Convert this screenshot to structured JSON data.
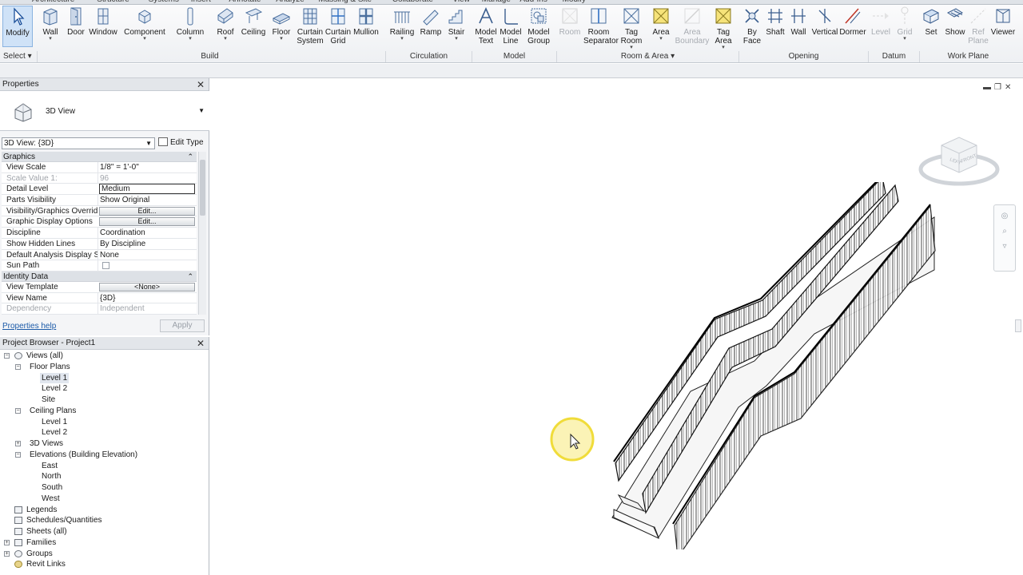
{
  "tabs": [
    "Architecture",
    "Structure",
    "Systems",
    "Insert",
    "Annotate",
    "Analyze",
    "Massing & Site",
    "Collaborate",
    "View",
    "Manage",
    "Add-Ins",
    "Modify"
  ],
  "ribbon": {
    "select": {
      "modify": "Modify",
      "select": "Select"
    },
    "build": {
      "wall": "Wall",
      "door": "Door",
      "window": "Window",
      "component": "Component",
      "column": "Column",
      "roof": "Roof",
      "ceiling": "Ceiling",
      "floor": "Floor",
      "curtain_system": [
        "Curtain",
        "System"
      ],
      "curtain_grid": [
        "Curtain",
        "Grid"
      ],
      "mullion": "Mullion",
      "panel": "Build"
    },
    "circulation": {
      "railing": "Railing",
      "ramp": "Ramp",
      "stair": "Stair",
      "panel": "Circulation"
    },
    "model": {
      "model_text": [
        "Model",
        "Text"
      ],
      "model_line": [
        "Model",
        "Line"
      ],
      "model_group": [
        "Model",
        "Group"
      ],
      "panel": "Model"
    },
    "room_area": {
      "room": "Room",
      "room_separator": [
        "Room",
        "Separator"
      ],
      "tag_room": [
        "Tag",
        "Room"
      ],
      "area": "Area",
      "area_boundary": [
        "Area",
        "Boundary"
      ],
      "tag_area": [
        "Tag",
        "Area"
      ],
      "panel": "Room & Area"
    },
    "opening": {
      "by_face": [
        "By",
        "Face"
      ],
      "shaft": "Shaft",
      "wall": "Wall",
      "vertical": "Vertical",
      "dormer": "Dormer",
      "panel": "Opening"
    },
    "datum": {
      "level": "Level",
      "grid": "Grid",
      "panel": "Datum"
    },
    "work_plane": {
      "set": "Set",
      "show": "Show",
      "ref_plane": [
        "Ref",
        "Plane"
      ],
      "viewer": "Viewer",
      "panel": "Work Plane"
    }
  },
  "properties": {
    "title": "Properties",
    "type_name": "3D View",
    "view_selector": "3D View: {3D}",
    "edit_type": "Edit Type",
    "groups": {
      "graphics": "Graphics",
      "identity": "Identity Data"
    },
    "rows": {
      "view_scale": {
        "k": "View Scale",
        "v": "1/8\" = 1'-0\""
      },
      "scale_value": {
        "k": "Scale Value    1:",
        "v": "96"
      },
      "detail_level": {
        "k": "Detail Level",
        "v": "Medium"
      },
      "parts_visibility": {
        "k": "Parts Visibility",
        "v": "Show Original"
      },
      "vg_overrides": {
        "k": "Visibility/Graphics Overrides",
        "v": "Edit..."
      },
      "graphic_display": {
        "k": "Graphic Display Options",
        "v": "Edit..."
      },
      "discipline": {
        "k": "Discipline",
        "v": "Coordination"
      },
      "hidden_lines": {
        "k": "Show Hidden Lines",
        "v": "By Discipline"
      },
      "analysis_display": {
        "k": "Default Analysis Display St...",
        "v": "None"
      },
      "sun_path": {
        "k": "Sun Path",
        "v": ""
      },
      "view_template": {
        "k": "View Template",
        "v": "<None>"
      },
      "view_name": {
        "k": "View Name",
        "v": "{3D}"
      },
      "dependency": {
        "k": "Dependency",
        "v": "Independent"
      }
    },
    "help": "Properties help",
    "apply": "Apply"
  },
  "browser": {
    "title": "Project Browser - Project1",
    "items": {
      "views_all": "Views (all)",
      "floor_plans": "Floor Plans",
      "fp_level1": "Level 1",
      "fp_level2": "Level 2",
      "fp_site": "Site",
      "ceiling_plans": "Ceiling Plans",
      "cp_level1": "Level 1",
      "cp_level2": "Level 2",
      "views_3d": "3D Views",
      "elevations": "Elevations (Building Elevation)",
      "east": "East",
      "north": "North",
      "south": "South",
      "west": "West",
      "legends": "Legends",
      "schedules": "Schedules/Quantities",
      "sheets": "Sheets (all)",
      "families": "Families",
      "groups": "Groups",
      "revit_links": "Revit Links"
    }
  },
  "viewcube": {
    "left": "LEFT",
    "front": "FRONT"
  },
  "colors": {
    "accent": "#2e6fc4",
    "cursor_highlight": "#f4e23c",
    "link": "#1b5aa8"
  },
  "icons": {
    "modify": "cursor-arrow-icon",
    "wall": "wall-icon",
    "door": "door-icon",
    "window": "window-icon",
    "component": "component-icon",
    "column": "column-icon",
    "roof": "roof-icon",
    "ceiling": "ceiling-icon",
    "floor": "floor-icon",
    "curtain_system": "curtain-system-icon",
    "curtain_grid": "curtain-grid-icon",
    "mullion": "mullion-icon",
    "railing": "railing-icon",
    "ramp": "ramp-icon",
    "stair": "stair-icon",
    "model_text": "model-text-icon",
    "model_line": "model-line-icon",
    "model_group": "model-group-icon",
    "room": "room-icon",
    "room_separator": "room-separator-icon",
    "tag_room": "tag-room-icon",
    "area": "area-icon",
    "area_boundary": "area-boundary-icon",
    "tag_area": "tag-area-icon",
    "by_face": "by-face-icon",
    "shaft": "shaft-icon",
    "opening_wall": "wall-opening-icon",
    "vertical": "vertical-opening-icon",
    "dormer": "dormer-icon",
    "level": "level-icon",
    "grid": "grid-icon",
    "set": "set-workplane-icon",
    "show": "show-workplane-icon",
    "ref_plane": "ref-plane-icon",
    "viewer": "viewer-icon"
  }
}
